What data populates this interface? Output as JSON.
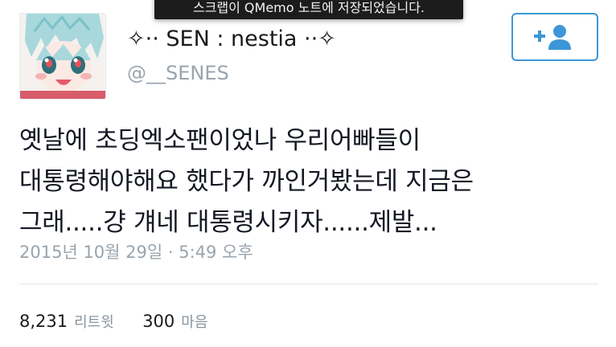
{
  "toast": {
    "message": "스크랩이 QMemo 노트에 저장되었습니다."
  },
  "profile": {
    "display_name": "✧·· SEN : nestia ··✧",
    "handle": "@__SENES",
    "avatar": "avatar-image"
  },
  "follow_button": {
    "icon": "add-person-icon",
    "accent_color": "#3c96d8"
  },
  "tweet": {
    "lines": [
      "옛날에 초딩엑소팬이었나 우리어빠들이",
      "대통령해야해요 했다가 까인거봤는데 지금은",
      "그래.....걍 걔네 대통령시키자......제발..."
    ],
    "timestamp": "2015년 10월 29일 · 5:49 오후"
  },
  "stats": {
    "retweets_count": "8,231",
    "retweets_label": "리트윗",
    "likes_count": "300",
    "likes_label": "마음"
  }
}
